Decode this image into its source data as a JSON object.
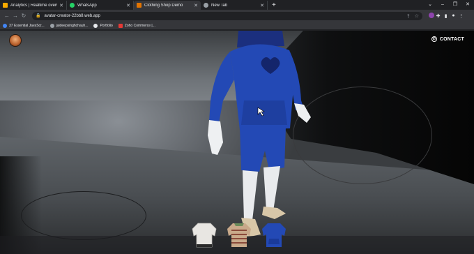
{
  "tabs": [
    {
      "title": "Analytics | Realtime overview",
      "color": "#f9ab00"
    },
    {
      "title": "WhatsApp",
      "color": "#25d366"
    },
    {
      "title": "Clothing Shop Demo",
      "color": "#e37400"
    },
    {
      "title": "New Tab",
      "color": "#9aa0a6"
    }
  ],
  "active_tab": 2,
  "address_bar": {
    "url": "avatar-creator-22bb8.web.app"
  },
  "bookmarks": [
    {
      "label": "37 Essential JavaScr...",
      "color": "#4285f4"
    },
    {
      "label": "jaideepsinghchauh...",
      "color": "#9aa0a6"
    },
    {
      "label": "Portfolio",
      "color": "#e8eaed"
    },
    {
      "label": "Zoho Commerce |...",
      "color": "#e53935"
    }
  ],
  "page": {
    "contact_label": "CONTACT",
    "accent": "#2349b5"
  },
  "outfit_options": [
    {
      "name": "white-sweater-option",
      "color": "#e8e6e2"
    },
    {
      "name": "striped-sweater-option",
      "color": "#c9a98a"
    },
    {
      "name": "blue-hoodie-option",
      "color": "#2349b5"
    }
  ]
}
